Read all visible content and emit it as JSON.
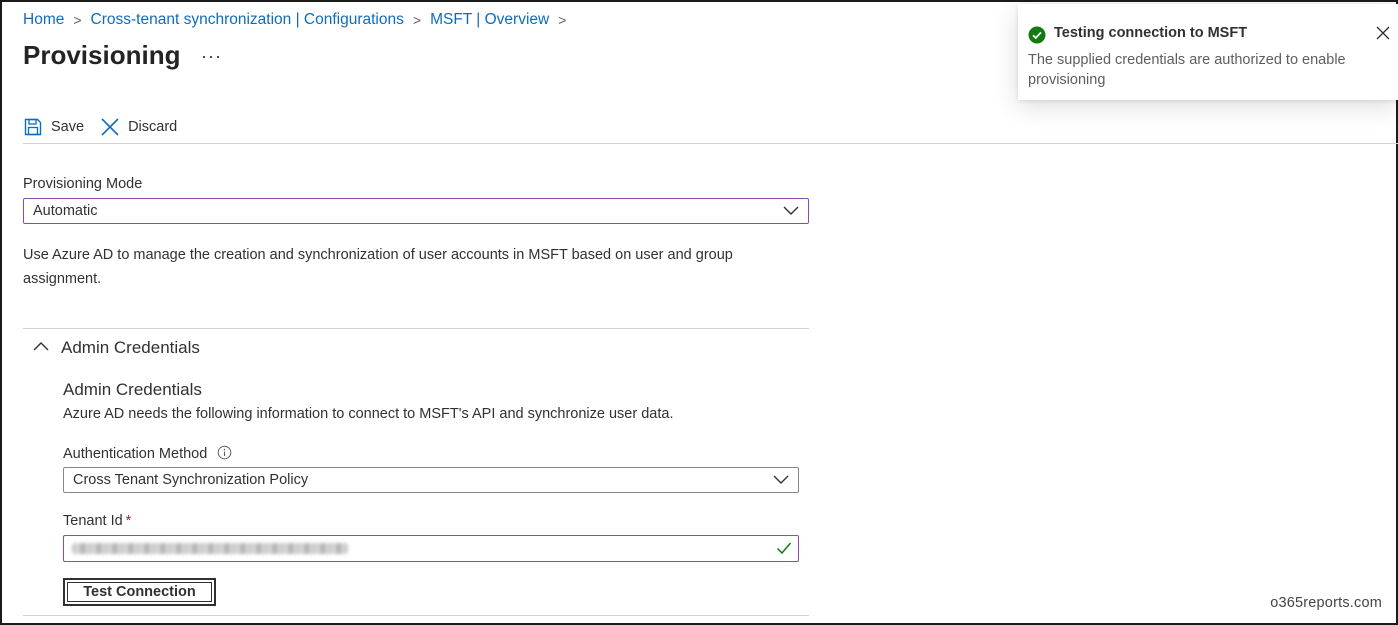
{
  "breadcrumb": {
    "items": [
      {
        "label": "Home"
      },
      {
        "label": "Cross-tenant synchronization | Configurations"
      },
      {
        "label": "MSFT | Overview"
      }
    ],
    "separator": ">"
  },
  "page": {
    "title": "Provisioning",
    "more": "···"
  },
  "toolbar": {
    "save_label": "Save",
    "discard_label": "Discard"
  },
  "provisioning_mode": {
    "label": "Provisioning Mode",
    "value": "Automatic"
  },
  "description": "Use Azure AD to manage the creation and synchronization of user accounts in MSFT based on user and group assignment.",
  "admin_section": {
    "header": "Admin Credentials",
    "expanded": true,
    "sub_title": "Admin Credentials",
    "sub_desc": "Azure AD needs the following information to connect to MSFT's API and synchronize user data.",
    "auth_method": {
      "label": "Authentication Method",
      "value": "Cross Tenant Synchronization Policy"
    },
    "tenant_id": {
      "label": "Tenant Id",
      "required_marker": "*"
    },
    "test_button": "Test Connection"
  },
  "toast": {
    "title": "Testing connection to MSFT",
    "message": "The supplied credentials are authorized to enable provisioning"
  },
  "watermark": "o365reports.com",
  "colors": {
    "link": "#0f6cbd",
    "focus_border": "#8e4ab3",
    "success": "#107c10",
    "required": "#a4262c"
  },
  "icons": {
    "save": "save-icon",
    "discard": "close-icon",
    "dropdown": "chevron-down-icon",
    "collapse": "chevron-up-icon",
    "info": "info-icon",
    "valid": "checkmark-icon",
    "toast_status": "success-icon",
    "toast_close": "close-icon"
  }
}
